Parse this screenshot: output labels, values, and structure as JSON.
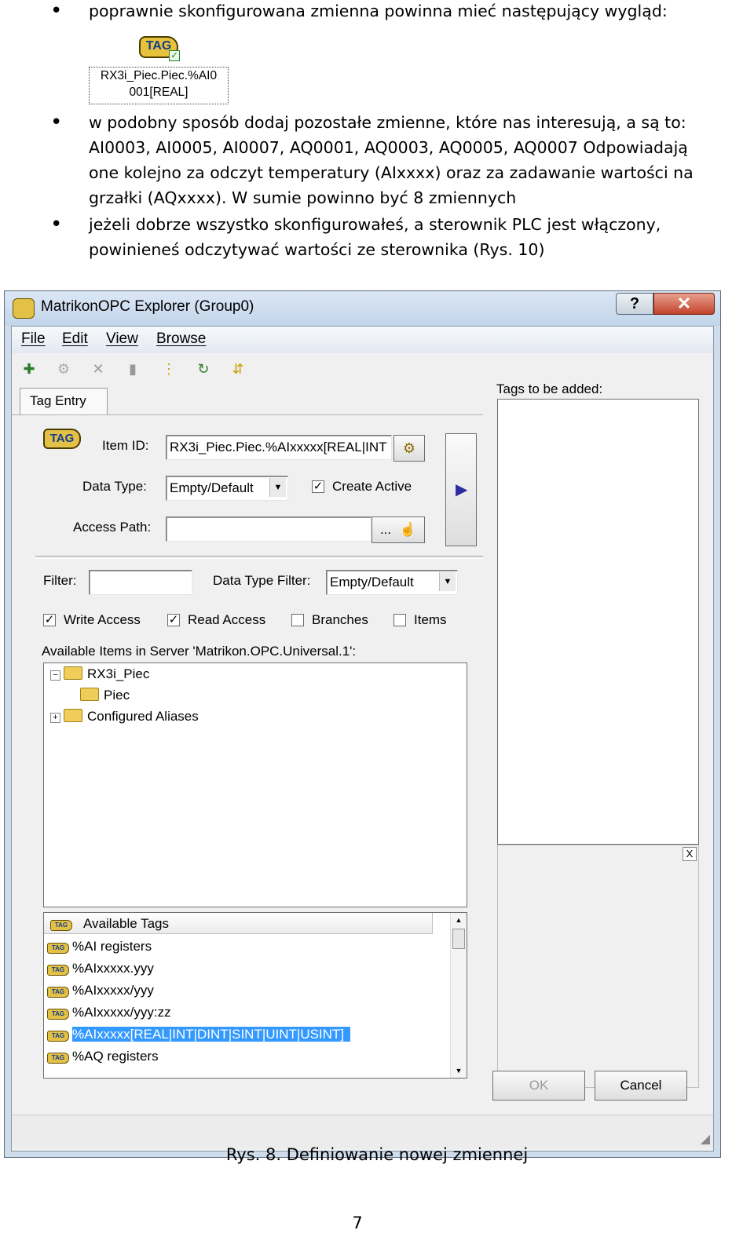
{
  "doc": {
    "bullet1": "poprawnie skonfigurowana zmienna powinna mieć następujący wygląd:",
    "tag_icon_text": "TAG",
    "tag_label_line1": "RX3i_Piec.Piec.%AI0",
    "tag_label_line2": "001[REAL]",
    "bullet2_line1": "w podobny sposób dodaj pozostałe zmienne, które nas interesują, a są to:",
    "bullet2_line2": "AI0003, AI0005, AI0007, AQ0001, AQ0003, AQ0005, AQ0007 Odpowiadają",
    "bullet2_line3": "one kolejno za odczyt temperatury (AIxxxx) oraz za zadawanie wartości na",
    "bullet2_line4": "grzałki (AQxxxx). W sumie powinno być 8 zmiennych",
    "bullet3_line1": "jeżeli dobrze wszystko skonfigurowałeś, a sterownik PLC jest włączony,",
    "bullet3_line2": "powinieneś odczytywać wartości ze sterownika (Rys. 10)",
    "caption": "Rys. 8. Definiowanie nowej zmiennej",
    "page_number": "7"
  },
  "window": {
    "title": "MatrikonOPC Explorer (Group0)",
    "help": "?",
    "close": "✕",
    "menu": [
      "File",
      "Edit",
      "View",
      "Browse"
    ],
    "tab": "Tag Entry",
    "tags_to_be_added": "Tags to be added:",
    "item_id_label": "Item ID:",
    "item_id_value": "RX3i_Piec.Piec.%AIxxxxx[REAL|INT",
    "data_type_label": "Data Type:",
    "data_type_value": "Empty/Default",
    "create_active_label": "Create Active",
    "create_active_checked": true,
    "access_path_label": "Access Path:",
    "access_path_value": "",
    "dots": "...",
    "filter_label": "Filter:",
    "filter_value": "",
    "data_type_filter_label": "Data Type Filter:",
    "data_type_filter_value": "Empty/Default",
    "write_access": "Write Access",
    "read_access": "Read Access",
    "branches": "Branches",
    "items": "Items",
    "available_items_label": "Available Items in Server 'Matrikon.OPC.Universal.1':",
    "tree": [
      "RX3i_Piec",
      "Piec",
      "Configured Aliases"
    ],
    "available_tags_header": "Available Tags",
    "tags": [
      "%AI registers",
      "%AIxxxxx.yyy",
      "%AIxxxxx/yyy",
      "%AIxxxxx/yyy:zz",
      "%AIxxxxx[REAL|INT|DINT|SINT|UINT|USINT]",
      "%AQ registers"
    ],
    "ok": "OK",
    "cancel": "Cancel",
    "panel_close": "X"
  }
}
